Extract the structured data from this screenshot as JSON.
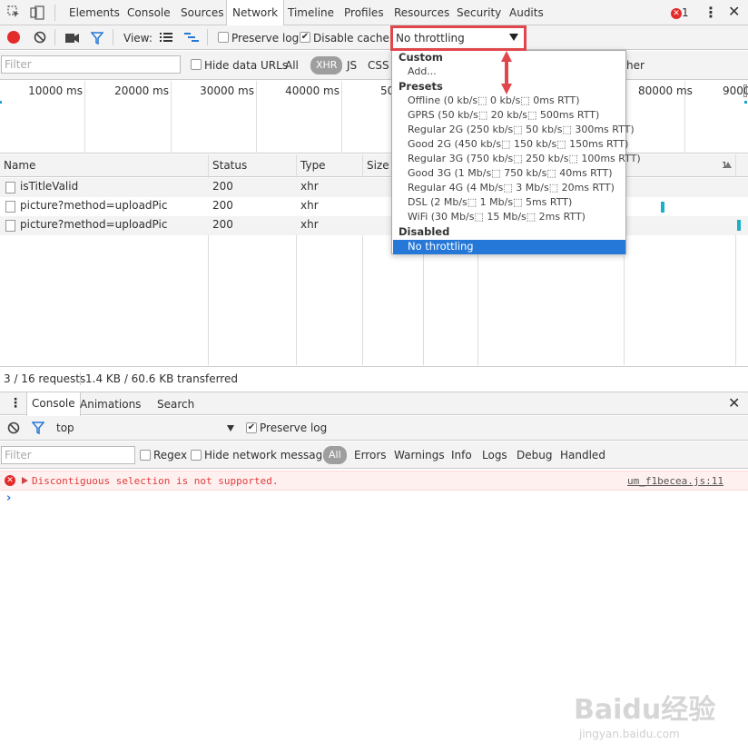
{
  "devtools": {
    "tabs": [
      "Elements",
      "Console",
      "Sources",
      "Network",
      "Timeline",
      "Profiles",
      "Resources",
      "Security",
      "Audits"
    ],
    "active_tab": "Network",
    "error_count": "1"
  },
  "network_toolbar": {
    "view_label": "View:",
    "preserve_log": "Preserve log",
    "preserve_log_checked": false,
    "disable_cache": "Disable cache",
    "disable_cache_checked": true,
    "throttling_value": "No throttling"
  },
  "filter_bar": {
    "placeholder": "Filter",
    "hide_data_urls": "Hide data URLs",
    "types": [
      "All",
      "XHR",
      "JS",
      "CSS"
    ],
    "active_type": "XHR",
    "other_partial": "her"
  },
  "timeline": {
    "ticks": [
      "10000 ms",
      "20000 ms",
      "30000 ms",
      "40000 ms",
      "50",
      "80000 ms",
      "9000"
    ]
  },
  "requests_table": {
    "columns": [
      "Name",
      "Status",
      "Type",
      "Size",
      "1"
    ],
    "rows": [
      {
        "name": "isTitleValid",
        "status": "200",
        "type": "xhr"
      },
      {
        "name": "picture?method=uploadPic",
        "status": "200",
        "type": "xhr"
      },
      {
        "name": "picture?method=uploadPic",
        "status": "200",
        "type": "xhr"
      }
    ]
  },
  "status_bar": {
    "requests": "3 / 16 requests",
    "transferred": "1.4 KB / 60.6 KB transferred"
  },
  "drawer": {
    "tabs": [
      "Console",
      "Animations",
      "Search"
    ],
    "active_tab": "Console"
  },
  "console_toolbar": {
    "context": "top",
    "preserve_log": "Preserve log",
    "preserve_log_checked": true
  },
  "console_filter": {
    "placeholder": "Filter",
    "regex": "Regex",
    "hide_network": "Hide network messages",
    "levels": [
      "All",
      "Errors",
      "Warnings",
      "Info",
      "Logs",
      "Debug",
      "Handled"
    ],
    "active_level": "All"
  },
  "console_messages": [
    {
      "level": "error",
      "text": "Discontiguous selection is not supported.",
      "source": "um_f1becea.js:11"
    }
  ],
  "throttling_dropdown": {
    "custom_header": "Custom",
    "custom_items": [
      "Add..."
    ],
    "presets_header": "Presets",
    "presets": [
      "Offline (0 kb/s⬚ 0 kb/s⬚ 0ms RTT)",
      "GPRS (50 kb/s⬚ 20 kb/s⬚ 500ms RTT)",
      "Regular 2G (250 kb/s⬚ 50 kb/s⬚ 300ms RTT)",
      "Good 2G (450 kb/s⬚ 150 kb/s⬚ 150ms RTT)",
      "Regular 3G (750 kb/s⬚ 250 kb/s⬚ 100ms RTT)",
      "Good 3G (1 Mb/s⬚ 750 kb/s⬚ 40ms RTT)",
      "Regular 4G (4 Mb/s⬚ 3 Mb/s⬚ 20ms RTT)",
      "DSL (2 Mb/s⬚ 1 Mb/s⬚ 5ms RTT)",
      "WiFi (30 Mb/s⬚ 15 Mb/s⬚ 2ms RTT)"
    ],
    "disabled_header": "Disabled",
    "selected_item": "No throttling"
  },
  "watermark": {
    "logo": "Baidu经验",
    "url": "jingyan.baidu.com"
  },
  "colors": {
    "accent_blue": "#2678d8",
    "record_red": "#e32b2b",
    "annotation_red": "#e0474c",
    "error_text": "#e23b3b",
    "error_bg": "#fff0f0"
  }
}
